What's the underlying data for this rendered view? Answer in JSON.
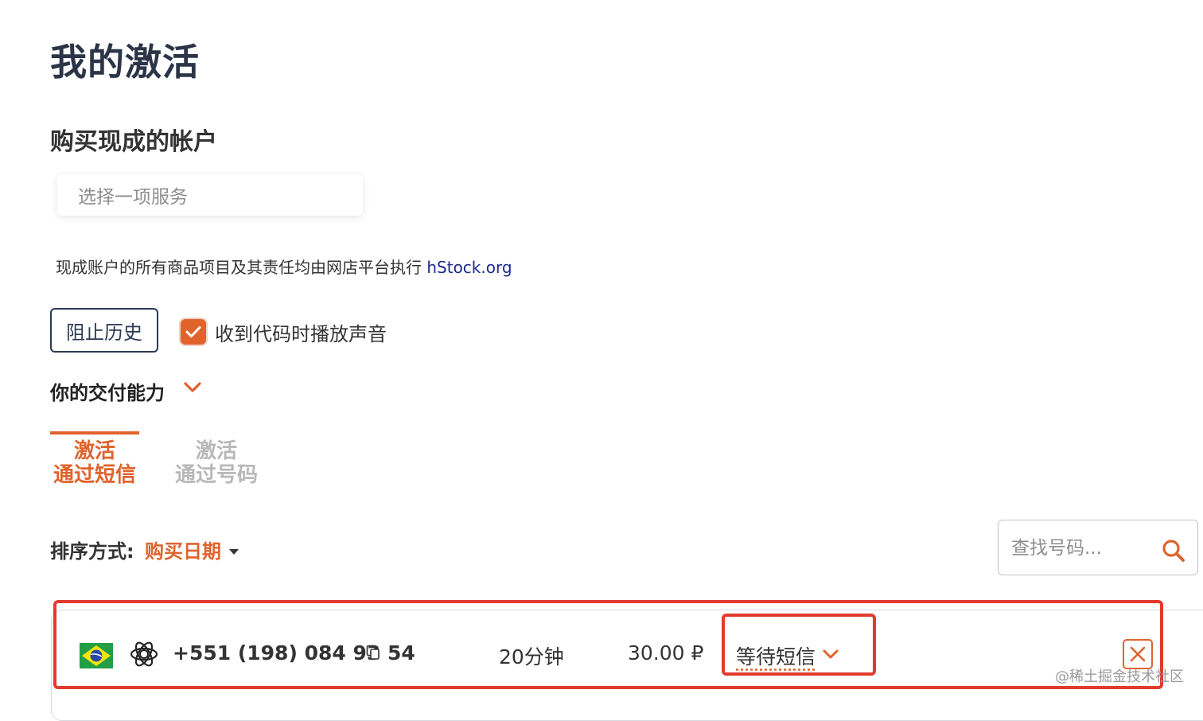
{
  "page": {
    "title": "我的激活"
  },
  "buy_accounts": {
    "heading": "购买现成的帐户",
    "service_placeholder": "选择一项服务",
    "disclaimer_text": "现成账户的所有商品项目及其责任均由网店平台执行 ",
    "disclaimer_link": "hStock.org"
  },
  "controls": {
    "block_history": "阻止历史",
    "sound_checked": true,
    "sound_label": "收到代码时播放声音"
  },
  "delivery": {
    "label": "你的交付能力"
  },
  "tabs": [
    {
      "line1": "激活",
      "line2": "通过短信",
      "active": true
    },
    {
      "line1": "激活",
      "line2": "通过号码",
      "active": false
    }
  ],
  "sort": {
    "label": "排序方式:",
    "value": "购买日期"
  },
  "search": {
    "placeholder": "查找号码..."
  },
  "activations": [
    {
      "country_flag": "brazil-flag",
      "service_icon": "openai-icon",
      "phone": "+551 (198) 084 93 54",
      "duration": "20分钟",
      "price": "30.00 ₽",
      "status": "等待短信"
    }
  ],
  "colors": {
    "accent": "#e0632c",
    "title": "#2c3548",
    "link": "#1c2a8c",
    "highlight": "#e23a2c"
  },
  "watermark": "@稀土掘金技术社区"
}
